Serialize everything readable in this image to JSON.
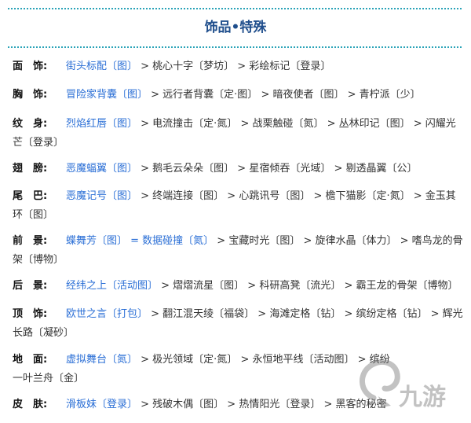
{
  "title": "饰品•特殊",
  "rows": [
    {
      "label": "面　饰:",
      "first": "街头标配〔图〕",
      "rest": " > 桃心十字〔梦坊〕 > 彩绘标记〔登录〕",
      "cont": ""
    },
    {
      "label": "胸　饰:",
      "first": "冒险家背囊〔图〕",
      "rest": " > 远行者背囊〔定·图〕 > 暗夜使者〔图〕 > 青柠派〔少〕",
      "cont": ""
    },
    {
      "label": "纹　身:",
      "first": "烈焰红唇〔图〕",
      "rest": " > 电流撞击〔定·氮〕 > 战栗触碰〔氮〕 > 丛林印记〔图〕 > 闪耀光",
      "cont": "芒〔登录〕"
    },
    {
      "label": "翅　膀:",
      "first": "恶魔蝠翼〔图〕",
      "rest": " > 鹅毛云朵朵〔图〕 > 星宿倾吞〔光域〕 > 剔透晶翼〔公〕",
      "cont": ""
    },
    {
      "label": "尾　巴:",
      "first": "恶魔记号〔图〕",
      "rest": " > 终端连接〔图〕 > 心跳讯号〔图〕 > 檐下猫影〔定·氮〕 > 金玉其",
      "cont": "环〔图〕"
    },
    {
      "label": "前　景:",
      "first": "蝶舞芳〔图〕 = 数据碰撞〔氮〕",
      "rest": " > 宝藏时光〔图〕 > 旋律水晶〔体力〕 > 嗜鸟龙的骨",
      "cont": "架〔博物〕"
    },
    {
      "label": "后　景:",
      "first": "经纬之上〔活动图〕",
      "rest": " > 熠熠流星〔图〕 > 科研高凳〔流光〕 > 霸王龙的骨架〔博物〕",
      "cont": ""
    },
    {
      "label": "顶　饰:",
      "first": "欧世之言〔打包〕",
      "rest": " > 翻江混天绫〔福袋〕 > 海滩定格〔钻〕 > 缤纷定格〔钻〕 > 辉光",
      "cont": "长路〔凝砂〕"
    },
    {
      "label": "地　面:",
      "first": "虚拟舞台〔氮〕",
      "rest": " > 极光领域〔定·氮〕 > 永恒地平线〔活动图〕 > 缤纷",
      "cont": "一叶兰舟〔金〕"
    },
    {
      "label": "皮　肤:",
      "first": "滑板妹〔登录〕",
      "rest": " > 残破木偶〔图〕 > 热情阳光〔登录〕 > 黑客的秘密",
      "cont": ""
    }
  ],
  "watermark": {
    "text": "九游",
    "icon": "jiuyou-logo-icon"
  }
}
